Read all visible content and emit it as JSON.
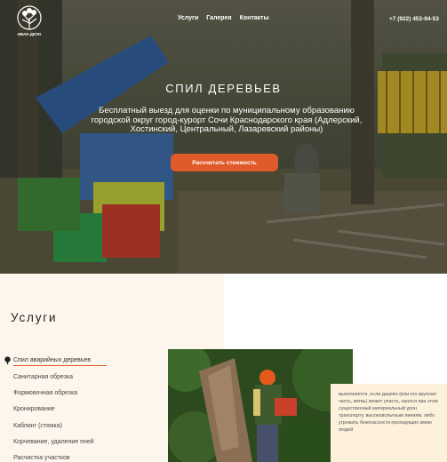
{
  "header": {
    "logo_text": "ИВАН ДЕЛО\nСПИЛ ДЕРЕВЬЕВ",
    "nav": [
      "Услуги",
      "Галерея",
      "Контакты"
    ],
    "phone": "+7 (922) 453-94-53"
  },
  "hero": {
    "title": "СПИЛ ДЕРЕВЬЕВ",
    "subtitle": "Бесплатный выезд для оценки по муниципальному образованию городской округ город-курорт Сочи Краснодарского края (Адлерский, Хостинский, Центральный, Лазаревский районы)",
    "cta": "Рассчитать стоимость"
  },
  "services": {
    "title": "Услуги",
    "items": [
      "Спил аварийных деревьев",
      "Санитарная обрезка",
      "Формовочная обрезка",
      "Кронирование",
      "Каблинг (стяжка)",
      "Корчевание, удаление пней",
      "Расчистка участков"
    ],
    "active_index": 0,
    "description": "выполняется, если дерево (или его крупная часть, ветвь) может упасть, нанося при этом существенный материальный урон транспорту, высоковольтным линиям, либо угрожать безопасности проходящих мимо людей"
  },
  "colors": {
    "accent": "#e05a2a",
    "services_bg": "#fdf6ec",
    "card_bg": "#fdf1dc"
  },
  "icons": [
    "tree-logo-icon",
    "tree-bullet-icon"
  ]
}
